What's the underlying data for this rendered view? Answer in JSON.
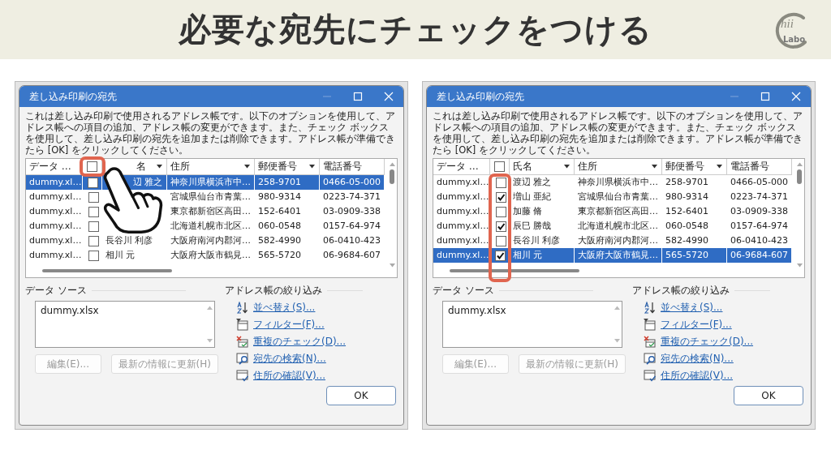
{
  "header": {
    "title": "必要な宛先にチェックをつける",
    "logo": {
      "mark": "hii",
      "sub": "Labo"
    }
  },
  "dialogs": [
    {
      "title": "差し込み印刷の宛先",
      "highlight_header_checkbox": true,
      "highlight_checkbox_column": false,
      "pointer": true,
      "description": "これは差し込み印刷で使用されるアドレス帳です。以下のオプションを使用して、アドレス帳への項目の追加、アドレス帳の変更ができます。また、チェック ボックスを使用して、差し込み印刷の宛先を追加または削除できます。アドレス帳が準備できたら [OK] をクリックしてください。",
      "columns": [
        {
          "kind": "source",
          "label": "データ …",
          "sortable": false
        },
        {
          "kind": "check",
          "checked": false
        },
        {
          "kind": "name",
          "label": "名",
          "sortable": true
        },
        {
          "kind": "address",
          "label": "住所",
          "sortable": true
        },
        {
          "kind": "zip",
          "label": "郵便番号",
          "sortable": true
        },
        {
          "kind": "phone",
          "label": "電話番号",
          "sortable": false
        }
      ],
      "rows": [
        {
          "source": "dummy.xl…",
          "checked": false,
          "name": "辺 雅之",
          "address": "神奈川県横浜市中…",
          "zip": "258-9701",
          "phone": "0466-05-000",
          "selected": true
        },
        {
          "source": "dummy.xl…",
          "checked": false,
          "address": "宮城県仙台市青葉…",
          "zip": "980-9314",
          "phone": "0223-74-371",
          "selected": false
        },
        {
          "source": "dummy.xl…",
          "checked": false,
          "address": "東京都新宿区高田…",
          "zip": "152-6401",
          "phone": "03-0909-338",
          "selected": false
        },
        {
          "source": "dummy.xl…",
          "checked": false,
          "address": "北海道札幌市北区…",
          "zip": "060-0548",
          "phone": "0157-64-974",
          "selected": false
        },
        {
          "source": "dummy.xl…",
          "checked": false,
          "name": "長谷川 利彦",
          "address": "大阪府南河内郡河…",
          "zip": "582-4990",
          "phone": "06-0410-423",
          "selected": false
        },
        {
          "source": "dummy.xl…",
          "checked": false,
          "name": "相川 元",
          "address": "大阪府大阪市鶴見…",
          "zip": "565-5720",
          "phone": "06-9684-607",
          "selected": false
        }
      ],
      "data_source": {
        "label": "データ ソース",
        "items": [
          "dummy.xlsx"
        ],
        "buttons": [
          {
            "label": "編集(E)...",
            "disabled": true
          },
          {
            "label": "最新の情報に更新(H)",
            "disabled": true
          }
        ]
      },
      "filter": {
        "label": "アドレス帳の絞り込み",
        "links": [
          {
            "kind": "sort",
            "label": "並べ替え(S)..."
          },
          {
            "kind": "filter",
            "label": "フィルター(F)..."
          },
          {
            "kind": "duplicates",
            "label": "重複のチェック(D)..."
          },
          {
            "kind": "find",
            "label": "宛先の検索(N)..."
          },
          {
            "kind": "validate",
            "label": "住所の確認(V)..."
          }
        ]
      },
      "ok": "OK"
    },
    {
      "title": "差し込み印刷の宛先",
      "highlight_header_checkbox": false,
      "highlight_checkbox_column": true,
      "pointer": false,
      "description": "これは差し込み印刷で使用されるアドレス帳です。以下のオプションを使用して、アドレス帳への項目の追加、アドレス帳の変更ができます。また、チェック ボックスを使用して、差し込み印刷の宛先を追加または削除できます。アドレス帳が準備できたら [OK] をクリックしてください。",
      "columns": [
        {
          "kind": "source",
          "label": "データ …",
          "sortable": false
        },
        {
          "kind": "check",
          "checked": false
        },
        {
          "kind": "name",
          "label": "氏名",
          "sortable": true
        },
        {
          "kind": "address",
          "label": "住所",
          "sortable": true
        },
        {
          "kind": "zip",
          "label": "郵便番号",
          "sortable": true
        },
        {
          "kind": "phone",
          "label": "電話番号",
          "sortable": false
        }
      ],
      "rows": [
        {
          "source": "dummy.xl…",
          "checked": false,
          "name": "渡辺 雅之",
          "address": "神奈川県横浜市中…",
          "zip": "258-9701",
          "phone": "0466-05-000",
          "selected": false
        },
        {
          "source": "dummy.xl…",
          "checked": true,
          "name": "増山 亜紀",
          "address": "宮城県仙台市青葉…",
          "zip": "980-9314",
          "phone": "0223-74-371",
          "selected": false
        },
        {
          "source": "dummy.xl…",
          "checked": false,
          "name": "加藤 脩",
          "address": "東京都新宿区高田…",
          "zip": "152-6401",
          "phone": "03-0909-338",
          "selected": false
        },
        {
          "source": "dummy.xl…",
          "checked": true,
          "name": "辰巳 勝哉",
          "address": "北海道札幌市北区…",
          "zip": "060-0548",
          "phone": "0157-64-974",
          "selected": false
        },
        {
          "source": "dummy.xl…",
          "checked": false,
          "name": "長谷川 利彦",
          "address": "大阪府南河内郡河…",
          "zip": "582-4990",
          "phone": "06-0410-423",
          "selected": false
        },
        {
          "source": "dummy.xl…",
          "checked": true,
          "name": "相川 元",
          "address": "大阪府大阪市鶴見…",
          "zip": "565-5720",
          "phone": "06-9684-607",
          "selected": true
        }
      ],
      "data_source": {
        "label": "データ ソース",
        "items": [
          "dummy.xlsx"
        ],
        "buttons": [
          {
            "label": "編集(E)...",
            "disabled": true
          },
          {
            "label": "最新の情報に更新(H)",
            "disabled": true
          }
        ]
      },
      "filter": {
        "label": "アドレス帳の絞り込み",
        "links": [
          {
            "kind": "sort",
            "label": "並べ替え(S)..."
          },
          {
            "kind": "filter",
            "label": "フィルター(F)..."
          },
          {
            "kind": "duplicates",
            "label": "重複のチェック(D)..."
          },
          {
            "kind": "find",
            "label": "宛先の検索(N)..."
          },
          {
            "kind": "validate",
            "label": "住所の確認(V)..."
          }
        ]
      },
      "ok": "OK"
    }
  ]
}
